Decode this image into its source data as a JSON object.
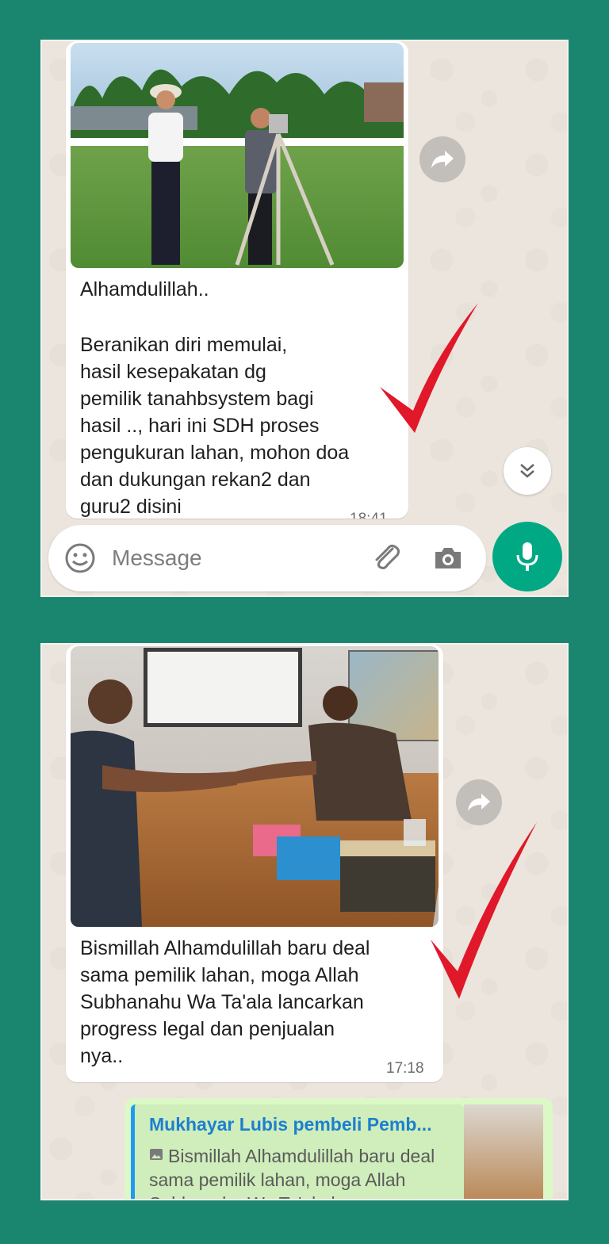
{
  "panel1": {
    "message": {
      "caption_line1": "Alhamdulillah..",
      "caption_body": "Beranikan diri memulai,\nhasil kesepakatan dg\npemilik tanahbsystem bagi\nhasil .., hari ini SDH proses\npengukuran lahan, mohon doa\ndan dukungan rekan2 dan\nguru2 disini",
      "time": "18:41",
      "photo_icon": "field-survey-photo"
    },
    "input": {
      "placeholder": "Message",
      "emoji_icon": "emoji-icon",
      "attach_icon": "paperclip-icon",
      "camera_icon": "camera-icon",
      "mic_icon": "microphone-icon"
    },
    "forward_icon": "forward-icon",
    "scroll_icon": "double-chevron-down-icon"
  },
  "panel2": {
    "message": {
      "caption": "Bismillah Alhamdulillah baru deal\nsama pemilik lahan, moga Allah\nSubhanahu Wa Ta'ala lancarkan\nprogress legal dan penjualan\nnya..",
      "time": "17:18",
      "photo_icon": "handshake-photo"
    },
    "reply": {
      "quoted_name": "Mukhayar Lubis pembeli Pemb...",
      "quoted_text": "Bismillah Alhamdulillah baru deal sama pemilik lahan, moga Allah Subhanahu Wa Ta'ala lanc..."
    },
    "forward_icon": "forward-icon"
  },
  "colors": {
    "background": "#1b8670",
    "chat_bg": "#ece5dd",
    "incoming_bubble": "#ffffff",
    "outgoing_bubble": "#dcf8c6",
    "accent_green": "#00a884",
    "checkmark_red": "#e0182a",
    "quote_name_blue": "#1d7fcf"
  }
}
